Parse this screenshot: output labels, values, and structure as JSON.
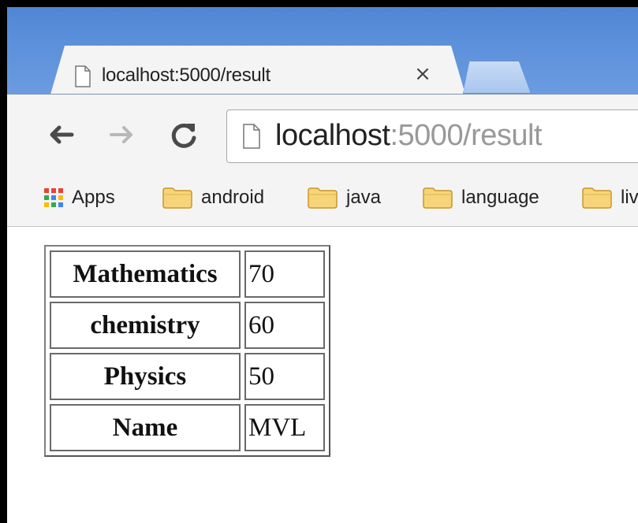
{
  "browser": {
    "tab": {
      "title": "localhost:5000/result",
      "close_glyph": "×"
    },
    "nav": {
      "back_glyph": "←",
      "forward_glyph": "→",
      "reload_glyph": "C"
    },
    "address": {
      "host": "localhost",
      "rest": ":5000/result"
    },
    "bookmarks": [
      {
        "label": "Apps",
        "icon": "apps-grid-icon"
      },
      {
        "label": "android",
        "icon": "folder-icon"
      },
      {
        "label": "java",
        "icon": "folder-icon"
      },
      {
        "label": "language",
        "icon": "folder-icon"
      },
      {
        "label": "liv",
        "icon": "folder-icon"
      }
    ]
  },
  "result_table": {
    "rows": [
      {
        "key": "Mathematics",
        "value": "70"
      },
      {
        "key": "chemistry",
        "value": "60"
      },
      {
        "key": "Physics",
        "value": "50"
      },
      {
        "key": "Name",
        "value": "MVL"
      }
    ]
  },
  "colors": {
    "titlebar": "#5a8fda",
    "toolbar": "#f4f4f4",
    "url_muted": "#999999",
    "folder": "#f2c443"
  }
}
